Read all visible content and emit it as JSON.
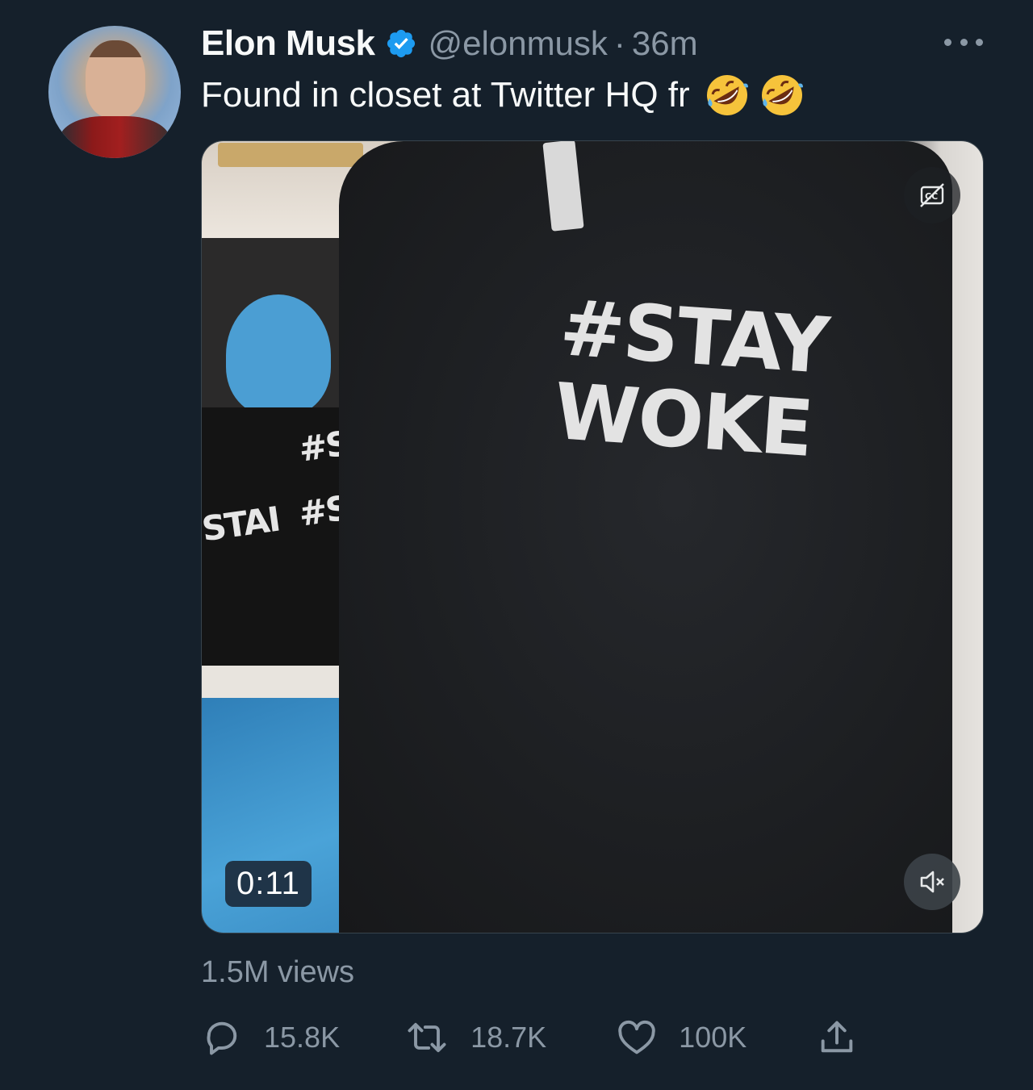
{
  "author": {
    "name": "Elon Musk",
    "handle": "@elonmusk",
    "separator": "·",
    "timestamp": "36m",
    "verified": true
  },
  "tweet": {
    "text": "Found in closet at Twitter HQ fr",
    "emojis": [
      "rolling-on-floor-laughing-emoji",
      "rolling-on-floor-laughing-emoji"
    ]
  },
  "media": {
    "type": "video",
    "duration": "0:11",
    "shirt_print_line1": "#STAY",
    "shirt_print_line2": "WOKE",
    "folded_print_1": "#STA",
    "folded_print_2": "#STA",
    "folded_print_3": "STAI",
    "captions_icon": "closed-captions-icon",
    "mute_icon": "muted-speaker-icon"
  },
  "stats": {
    "views": "1.5M views",
    "replies": "15.8K",
    "retweets": "18.7K",
    "likes": "100K"
  },
  "colors": {
    "background": "#15202b",
    "primary_text": "#f7f9f9",
    "secondary_text": "#8b98a5",
    "verified_badge": "#1d9bf0"
  }
}
